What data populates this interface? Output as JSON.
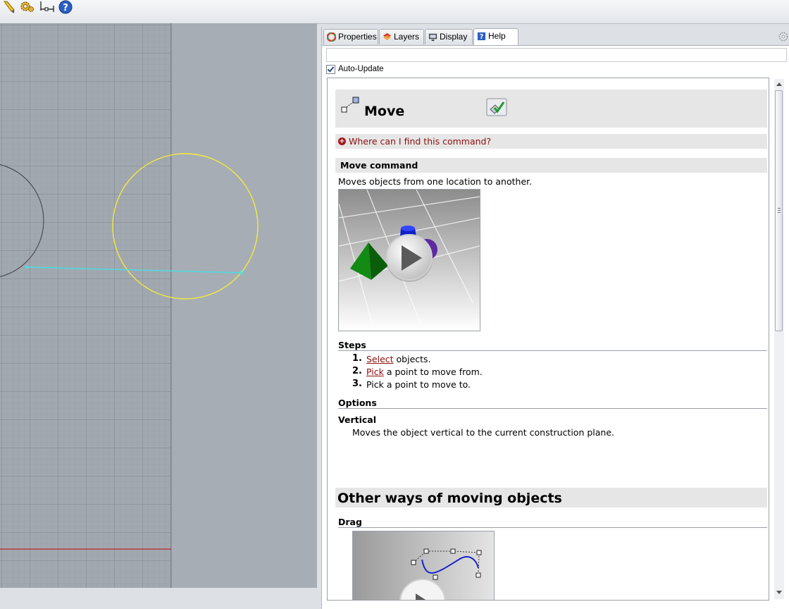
{
  "toolbar": {
    "icons": [
      "pencil-icon",
      "gear-icon",
      "dimension-icon",
      "help-icon"
    ]
  },
  "panel": {
    "tabs": [
      {
        "label": "Properties",
        "icon": "properties-color-wheel-icon"
      },
      {
        "label": "Layers",
        "icon": "layers-icon"
      },
      {
        "label": "Display",
        "icon": "display-monitor-icon"
      },
      {
        "label": "Help",
        "icon": "help-book-icon",
        "active": true
      }
    ],
    "url_value": "",
    "auto_update_label": "Auto-Update",
    "auto_update_checked": true
  },
  "help": {
    "title": "Move",
    "find_command": "Where can I find this command?",
    "command_header": "Move command",
    "description": "Moves objects from one location to another.",
    "steps_header": "Steps",
    "steps": [
      {
        "num": "1.",
        "link": "Select",
        "rest": " objects."
      },
      {
        "num": "2.",
        "link": "Pick",
        "rest": " a point to move from."
      },
      {
        "num": "3.",
        "link": "",
        "rest": "Pick a point to move to."
      }
    ],
    "options_header": "Options",
    "option_name": "Vertical",
    "option_desc": "Moves the object vertical to the current construction plane.",
    "other_ways_header": "Other ways of moving objects",
    "drag_header": "Drag"
  },
  "colors": {
    "accent_link": "#8b0f0f",
    "selection_circle": "#f0ec3a",
    "line": "#44e0e6",
    "viewport_bg": "#a7adb5"
  }
}
